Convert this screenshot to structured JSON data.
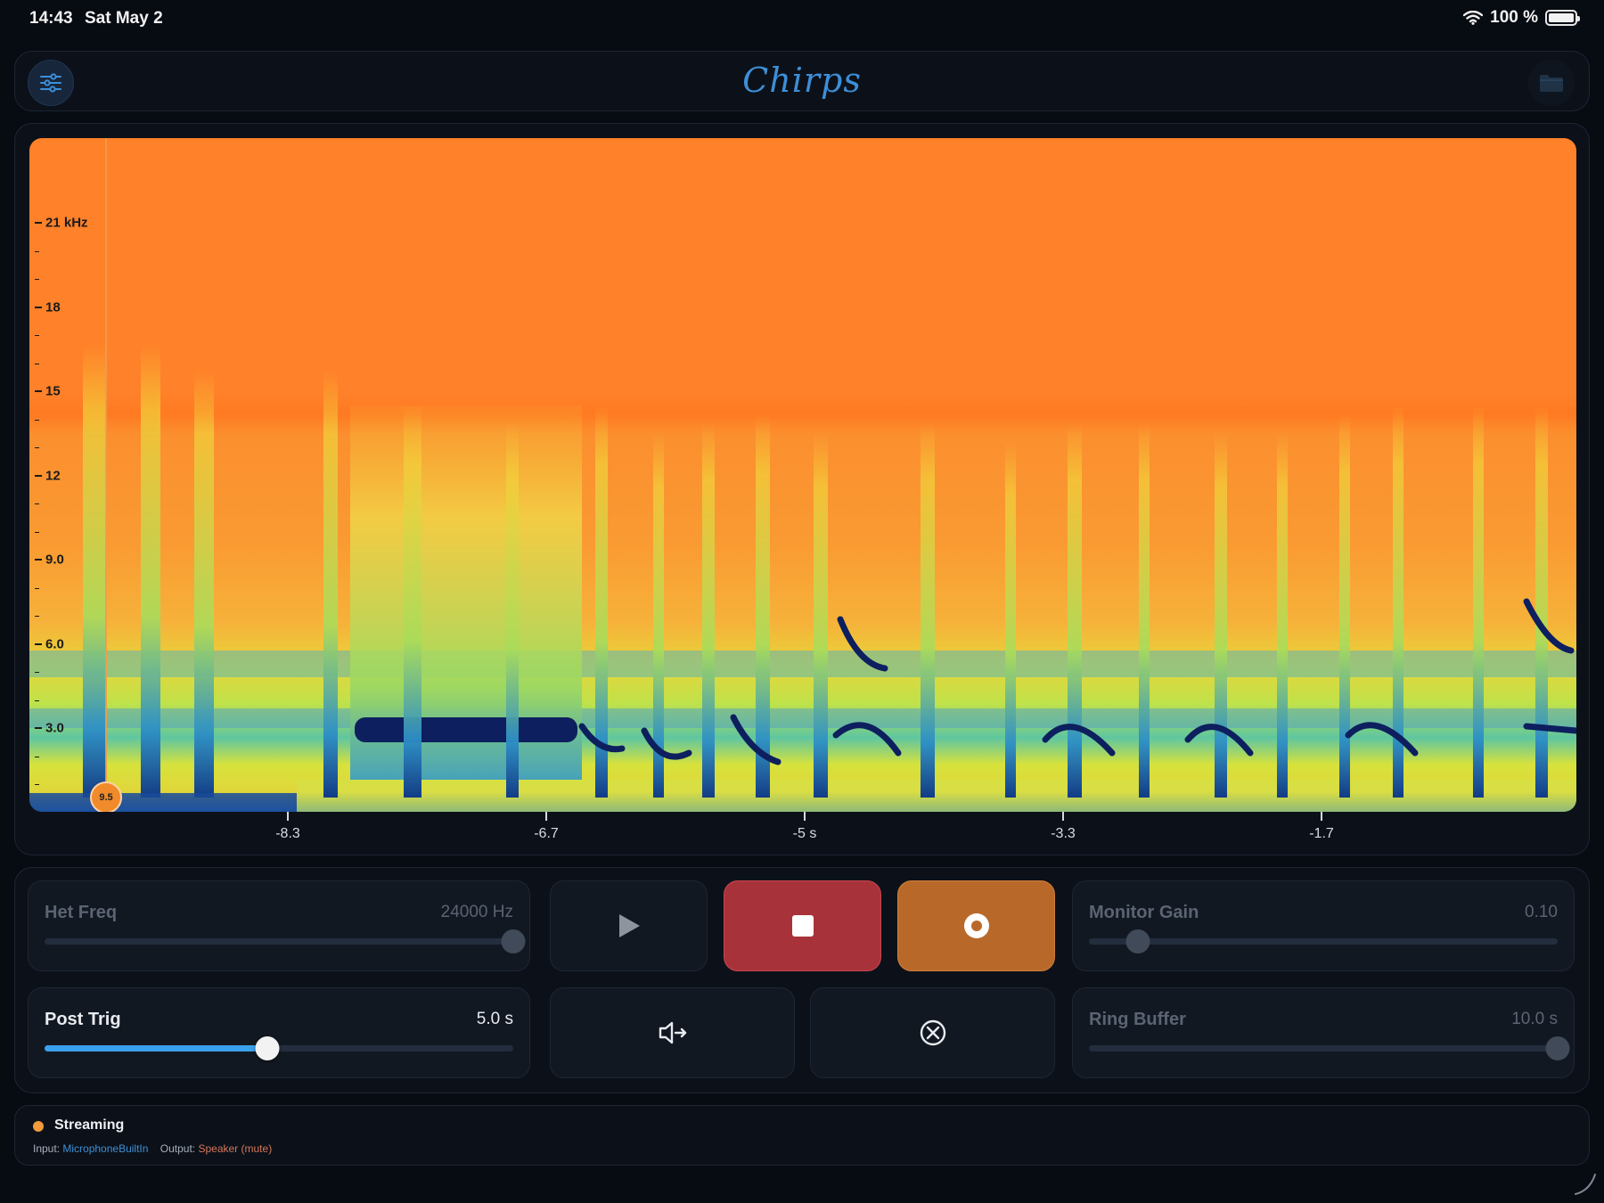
{
  "status_bar": {
    "time": "14:43",
    "date": "Sat May 2",
    "battery_text": "100 %",
    "battery_level": 1.0,
    "icons": [
      "wifi-icon",
      "battery-icon"
    ]
  },
  "header": {
    "title": "Chirps",
    "left_button_icon": "sliders-icon",
    "right_button_icon": "folder-icon",
    "accent_color": "#3d8fd8"
  },
  "spectrogram": {
    "y_labels": [
      "21 kHz",
      "18",
      "15",
      "12",
      "9.0",
      "6.0",
      "3.0"
    ],
    "x_labels": [
      "-8.3",
      "-6.7",
      "-5 s",
      "-3.3",
      "-1.7"
    ],
    "playhead_value": "9.5",
    "colors": {
      "background": "#ff8128",
      "mid": "#f2c21b",
      "low": "#2a6cb0",
      "deep": "#0b1e5a"
    }
  },
  "controls": {
    "het_freq": {
      "label": "Het Freq",
      "value": "24000 Hz",
      "level": 1.0
    },
    "monitor_gain": {
      "label": "Monitor Gain",
      "value": "0.10",
      "level": 0.1
    },
    "post_trig": {
      "label": "Post Trig",
      "value": "5.0 s",
      "level": 0.5
    },
    "ring_buffer": {
      "label": "Ring Buffer",
      "value": "10.0 s",
      "level": 1.0
    },
    "buttons": {
      "play_icon": "play-icon",
      "stop_icon": "stop-icon",
      "record_icon": "record-icon",
      "speaker_icon": "speaker-output-icon",
      "clear_icon": "clear-icon",
      "stop_color": "#a8323a",
      "record_color": "#b8692a"
    }
  },
  "footer": {
    "status": "Streaming",
    "status_color": "#f39a3a",
    "input_label": "Input:",
    "input_value": "MicrophoneBuiltIn",
    "output_label": "Output:",
    "output_value": "Speaker (mute)"
  }
}
